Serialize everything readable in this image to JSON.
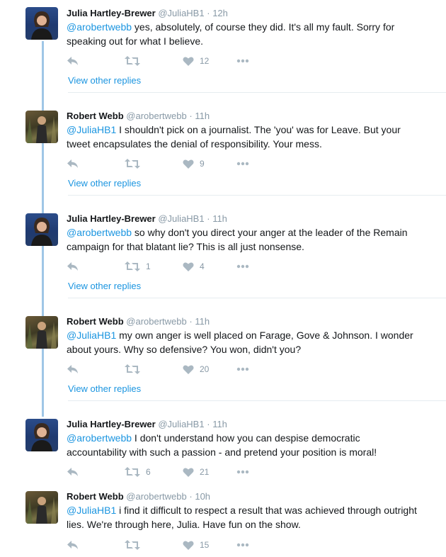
{
  "view_other_replies": "View other replies",
  "colors": {
    "accent": "#1b95e0",
    "thread": "#9fc6e6",
    "muted": "#8899a6",
    "icon": "#aab8c2"
  },
  "tweets": [
    {
      "name": "Julia Hartley-Brewer",
      "handle": "@JuliaHB1",
      "dot": "·",
      "time": "12h",
      "mention": "@arobertwebb",
      "text": " yes, absolutely, of course they did. It's all my fault. Sorry for speaking out for what I believe.",
      "retweets": "",
      "likes": "12"
    },
    {
      "name": "Robert Webb",
      "handle": "@arobertwebb",
      "dot": "·",
      "time": "11h",
      "mention": "@JuliaHB1",
      "text": " I shouldn't pick on a journalist. The 'you' was for Leave. But your tweet encapsulates the denial of responsibility. Your mess.",
      "retweets": "",
      "likes": "9"
    },
    {
      "name": "Julia Hartley-Brewer",
      "handle": "@JuliaHB1",
      "dot": "·",
      "time": "11h",
      "mention": "@arobertwebb",
      "text": " so why don't you direct your anger at the leader of the Remain campaign for that blatant lie? This is all just nonsense.",
      "retweets": "1",
      "likes": "4"
    },
    {
      "name": "Robert Webb",
      "handle": "@arobertwebb",
      "dot": "·",
      "time": "11h",
      "mention": "@JuliaHB1",
      "text": " my own anger is well placed on Farage, Gove & Johnson. I wonder about yours. Why so defensive? You won, didn't you?",
      "retweets": "",
      "likes": "20"
    },
    {
      "name": "Julia Hartley-Brewer",
      "handle": "@JuliaHB1",
      "dot": "·",
      "time": "11h",
      "mention": "@arobertwebb",
      "text": " I don't understand how you can despise democratic accountability with such a passion - and pretend your position is moral!",
      "retweets": "6",
      "likes": "21"
    },
    {
      "name": "Robert Webb",
      "handle": "@arobertwebb",
      "dot": "·",
      "time": "10h",
      "mention": "@JuliaHB1",
      "text": " i find it difficult to respect a result that was achieved through outright lies. We're through here, Julia. Have fun on the show.",
      "retweets": "",
      "likes": "15"
    }
  ]
}
